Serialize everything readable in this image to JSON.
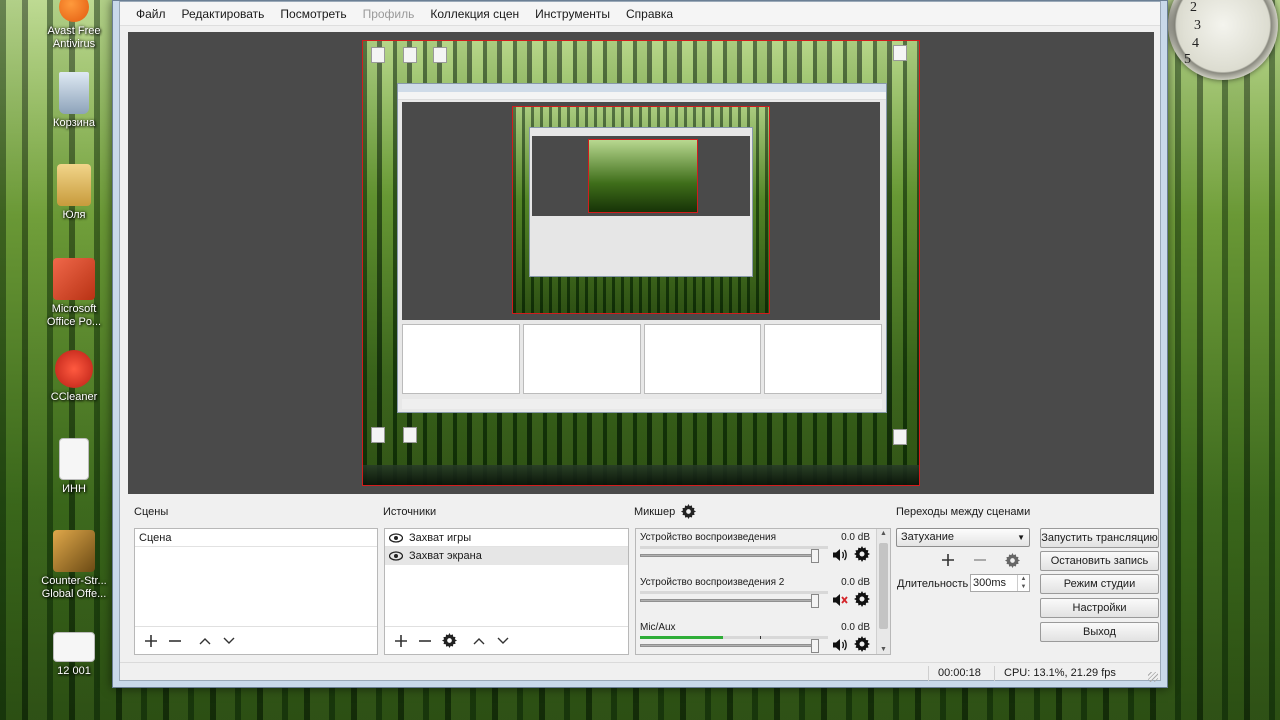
{
  "desktop": {
    "icons": [
      {
        "label": "Avast Free Antivirus",
        "color": "#f26522"
      },
      {
        "label": "Корзина",
        "color": "#9fb4c9"
      },
      {
        "label": "Юля",
        "color": "#d6b15a"
      },
      {
        "label": "Microsoft Office Po...",
        "color": "#d14424"
      },
      {
        "label": "CCleaner",
        "color": "#c8302a"
      },
      {
        "label": "ИНН",
        "color": "#f2f2f2"
      },
      {
        "label": "Counter-Str... Global Offe...",
        "color": "#b8852e"
      },
      {
        "label": "12 001",
        "color": "#f2f2f2"
      }
    ],
    "clock_numbers": [
      "2",
      "3",
      "4",
      "5"
    ]
  },
  "menubar": {
    "items": [
      {
        "label": "Файл",
        "enabled": true
      },
      {
        "label": "Редактировать",
        "enabled": true
      },
      {
        "label": "Посмотреть",
        "enabled": true
      },
      {
        "label": "Профиль",
        "enabled": false
      },
      {
        "label": "Коллекция сцен",
        "enabled": true
      },
      {
        "label": "Инструменты",
        "enabled": true
      },
      {
        "label": "Справка",
        "enabled": true
      }
    ]
  },
  "scenes": {
    "title": "Сцены",
    "items": [
      "Сцена"
    ],
    "tools": [
      "plus-icon",
      "minus-icon",
      "up-icon",
      "down-icon"
    ]
  },
  "sources": {
    "title": "Источники",
    "items": [
      "Захват игры",
      "Захват экрана"
    ],
    "tools": [
      "plus-icon",
      "minus-icon",
      "gear-icon",
      "up-icon",
      "down-icon"
    ]
  },
  "mixer": {
    "title": "Микшер",
    "channels": [
      {
        "name": "Устройство воспроизведения",
        "db": "0.0 dB",
        "level": 0.0,
        "muted": false
      },
      {
        "name": "Устройство воспроизведения 2",
        "db": "0.0 dB",
        "level": 0.0,
        "muted": true
      },
      {
        "name": "Mic/Aux",
        "db": "0.0 dB",
        "level": 0.44,
        "muted": false
      }
    ]
  },
  "transitions": {
    "title": "Переходы между сценами",
    "selected": "Затухание",
    "duration_label": "Длительность",
    "duration_value": "300ms"
  },
  "controls": {
    "start_stream": "Запустить трансляцию",
    "stop_record": "Остановить запись",
    "studio_mode": "Режим студии",
    "settings": "Настройки",
    "exit": "Выход"
  },
  "status": {
    "time": "00:00:18",
    "cpu": "CPU: 13.1%, 21.29 fps"
  },
  "colors": {
    "selection_border": "#d21c1c",
    "meter_green": "#2fae38",
    "mute_red": "#d4262a"
  }
}
